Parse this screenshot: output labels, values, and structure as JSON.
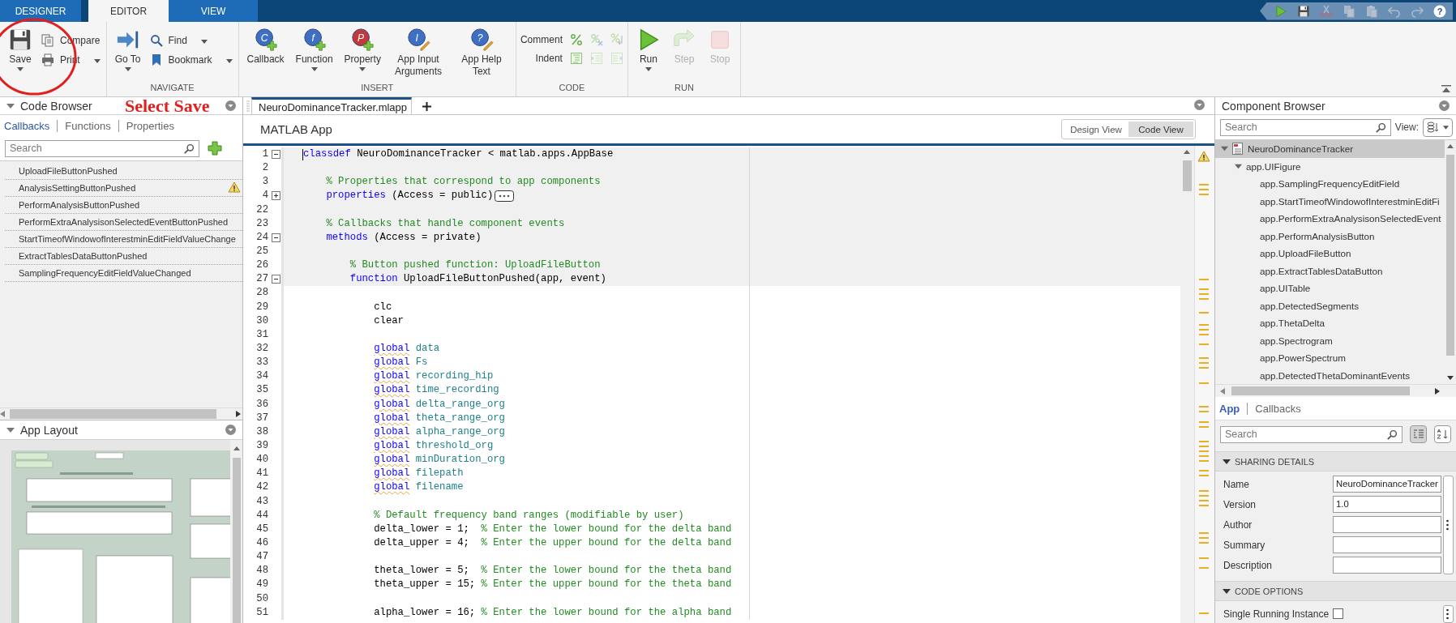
{
  "ribbon_tabs": [
    {
      "label": "DESIGNER",
      "selected": false
    },
    {
      "label": "EDITOR",
      "selected": true
    },
    {
      "label": "VIEW",
      "selected": false
    }
  ],
  "quick_access": [
    {
      "kind": "run",
      "disabled": false
    },
    {
      "kind": "save",
      "disabled": false
    },
    {
      "kind": "cut",
      "disabled": true
    },
    {
      "kind": "copy",
      "disabled": true
    },
    {
      "kind": "paste",
      "disabled": true
    },
    {
      "kind": "undo",
      "disabled": true
    },
    {
      "kind": "redo",
      "disabled": true
    },
    {
      "kind": "help",
      "disabled": false,
      "glyph": "?"
    }
  ],
  "ribbon": [
    {
      "large": [
        {
          "kind": "save",
          "label": "Save",
          "dropdown": true,
          "disabled": false
        }
      ],
      "small": [
        {
          "kind": "compare",
          "label": "Compare",
          "dropdown": false
        },
        {
          "kind": "print",
          "label": "Print",
          "dropdown": true
        }
      ]
    },
    {
      "label": "NAVIGATE",
      "large": [
        {
          "kind": "goto",
          "label": "Go To",
          "dropdown": true,
          "disabled": false
        }
      ],
      "small": [
        {
          "kind": "find",
          "label": "Find",
          "dropdown": true
        },
        {
          "kind": "bookmark",
          "label": "Bookmark",
          "dropdown": true
        }
      ]
    },
    {
      "label": "INSERT",
      "large": [
        {
          "kind": "callback",
          "label": "Callback",
          "glyph": "C",
          "dropdown": false,
          "disabled": false
        },
        {
          "kind": "function",
          "label": "Function",
          "glyph": "f",
          "dropdown": true,
          "disabled": false
        },
        {
          "kind": "property",
          "label": "Property",
          "glyph": "P",
          "dropdown": true,
          "disabled": false
        },
        {
          "kind": "app-input",
          "label": "App Input Arguments",
          "glyph": "I",
          "dropdown": false,
          "disabled": false
        },
        {
          "kind": "app-help",
          "label": "App Help Text",
          "glyph": "?",
          "dropdown": false,
          "disabled": false
        }
      ]
    },
    {
      "label": "CODE",
      "icon_rows": [
        {
          "label": "Comment",
          "tools": [
            {
              "kind": "comment",
              "disabled": false
            },
            {
              "kind": "uncomment",
              "disabled": true
            },
            {
              "kind": "wrap-comment",
              "disabled": true
            }
          ]
        },
        {
          "label": "Indent",
          "tools": [
            {
              "kind": "smart-indent",
              "disabled": false
            },
            {
              "kind": "increase-indent",
              "disabled": true
            },
            {
              "kind": "decrease-indent",
              "disabled": true
            }
          ]
        }
      ]
    },
    {
      "label": "RUN",
      "large": [
        {
          "kind": "run",
          "label": "Run",
          "dropdown": true,
          "disabled": false
        },
        {
          "kind": "step",
          "label": "Step",
          "dropdown": false,
          "disabled": true
        },
        {
          "kind": "stop",
          "label": "Stop",
          "dropdown": false,
          "disabled": true
        }
      ]
    }
  ],
  "annotation": {
    "text": "Select Save"
  },
  "code_browser": {
    "title": "Code Browser",
    "tabs": [
      {
        "label": "Callbacks",
        "selected": true
      },
      {
        "label": "Functions",
        "selected": false
      },
      {
        "label": "Properties",
        "selected": false
      }
    ],
    "search": {
      "placeholder": "Search"
    },
    "items": [
      {
        "label": "UploadFileButtonPushed",
        "warning": false
      },
      {
        "label": "AnalysisSettingButtonPushed",
        "warning": true
      },
      {
        "label": "PerformAnalysisButtonPushed",
        "warning": false
      },
      {
        "label": "PerformExtraAnalysisonSelectedEventButtonPushed",
        "warning": false
      },
      {
        "label": "StartTimeofWindowofInterestminEditFieldValueChange",
        "warning": false
      },
      {
        "label": "ExtractTablesDataButtonPushed",
        "warning": false
      },
      {
        "label": "SamplingFrequencyEditFieldValueChanged",
        "warning": false
      }
    ]
  },
  "app_layout": {
    "title": "App Layout"
  },
  "editor": {
    "file_tab": {
      "label": "NeuroDominanceTracker.mlapp",
      "selected": true
    },
    "title": "MATLAB App",
    "views": [
      {
        "label": "Design View",
        "selected": false
      },
      {
        "label": "Code View",
        "selected": true
      }
    ],
    "lines": [
      {
        "number": "1",
        "expanded": true,
        "editable": false,
        "cursor": true,
        "segments": [
          {
            "kind": "keyword",
            "text": "classdef"
          },
          {
            "kind": "plain",
            "text": " NeuroDominanceTracker < matlab.apps.AppBase"
          }
        ]
      },
      {
        "number": "2",
        "editable": false
      },
      {
        "number": "3",
        "editable": false,
        "segments": [
          {
            "kind": "comment",
            "text": "    % Properties that correspond to app components"
          }
        ]
      },
      {
        "number": "4",
        "expanded": false,
        "editable": false,
        "collapsed": true,
        "segments": [
          {
            "kind": "keyword",
            "text": "    properties"
          },
          {
            "kind": "plain",
            "text": " (Access = public)"
          }
        ]
      },
      {
        "number": "22",
        "editable": false
      },
      {
        "number": "23",
        "editable": false,
        "segments": [
          {
            "kind": "comment",
            "text": "    % Callbacks that handle component events"
          }
        ]
      },
      {
        "number": "24",
        "expanded": true,
        "editable": false,
        "segments": [
          {
            "kind": "keyword",
            "text": "    methods"
          },
          {
            "kind": "plain",
            "text": " (Access = private)"
          }
        ]
      },
      {
        "number": "25",
        "editable": false
      },
      {
        "number": "26",
        "editable": false,
        "segments": [
          {
            "kind": "comment",
            "text": "        % Button pushed function: UploadFileButton"
          }
        ]
      },
      {
        "number": "27",
        "expanded": true,
        "editable": false,
        "segments": [
          {
            "kind": "keyword",
            "text": "        function"
          },
          {
            "kind": "plain",
            "text": " UploadFileButtonPushed(app, event)"
          }
        ]
      },
      {
        "number": "28",
        "editable": true
      },
      {
        "number": "29",
        "editable": true,
        "segments": [
          {
            "kind": "plain",
            "text": "            clc"
          }
        ]
      },
      {
        "number": "30",
        "editable": true,
        "segments": [
          {
            "kind": "plain",
            "text": "            clear"
          }
        ]
      },
      {
        "number": "31",
        "editable": true
      },
      {
        "number": "32",
        "editable": true,
        "segments": [
          {
            "kind": "keyword",
            "text": "            global",
            "flagged": true
          },
          {
            "kind": "variable",
            "text": " data"
          }
        ]
      },
      {
        "number": "33",
        "editable": true,
        "segments": [
          {
            "kind": "keyword",
            "text": "            global",
            "flagged": true
          },
          {
            "kind": "variable",
            "text": " Fs"
          }
        ]
      },
      {
        "number": "34",
        "editable": true,
        "segments": [
          {
            "kind": "keyword",
            "text": "            global",
            "flagged": true
          },
          {
            "kind": "variable",
            "text": " recording_hip"
          }
        ]
      },
      {
        "number": "35",
        "editable": true,
        "segments": [
          {
            "kind": "keyword",
            "text": "            global",
            "flagged": true
          },
          {
            "kind": "variable",
            "text": " time_recording"
          }
        ]
      },
      {
        "number": "36",
        "editable": true,
        "segments": [
          {
            "kind": "keyword",
            "text": "            global",
            "flagged": true
          },
          {
            "kind": "variable",
            "text": " delta_range_org"
          }
        ]
      },
      {
        "number": "37",
        "editable": true,
        "segments": [
          {
            "kind": "keyword",
            "text": "            global",
            "flagged": true
          },
          {
            "kind": "variable",
            "text": " theta_range_org"
          }
        ]
      },
      {
        "number": "38",
        "editable": true,
        "segments": [
          {
            "kind": "keyword",
            "text": "            global",
            "flagged": true
          },
          {
            "kind": "variable",
            "text": " alpha_range_org"
          }
        ]
      },
      {
        "number": "39",
        "editable": true,
        "segments": [
          {
            "kind": "keyword",
            "text": "            global",
            "flagged": true
          },
          {
            "kind": "variable",
            "text": " threshold_org"
          }
        ]
      },
      {
        "number": "40",
        "editable": true,
        "segments": [
          {
            "kind": "keyword",
            "text": "            global",
            "flagged": true
          },
          {
            "kind": "variable",
            "text": " minDuration_org"
          }
        ]
      },
      {
        "number": "41",
        "editable": true,
        "segments": [
          {
            "kind": "keyword",
            "text": "            global",
            "flagged": true
          },
          {
            "kind": "variable",
            "text": " filepath"
          }
        ]
      },
      {
        "number": "42",
        "editable": true,
        "segments": [
          {
            "kind": "keyword",
            "text": "            global",
            "flagged": true
          },
          {
            "kind": "variable",
            "text": " filename"
          }
        ]
      },
      {
        "number": "43",
        "editable": true
      },
      {
        "number": "44",
        "editable": true,
        "segments": [
          {
            "kind": "comment",
            "text": "            % Default frequency band ranges (modifiable by user)"
          }
        ]
      },
      {
        "number": "45",
        "editable": true,
        "segments": [
          {
            "kind": "plain",
            "text": "            delta_lower = 1;  "
          },
          {
            "kind": "comment",
            "text": "% Enter the lower bound for the delta band"
          }
        ]
      },
      {
        "number": "46",
        "editable": true,
        "segments": [
          {
            "kind": "plain",
            "text": "            delta_upper = 4;  "
          },
          {
            "kind": "comment",
            "text": "% Enter the upper bound for the delta band"
          }
        ]
      },
      {
        "number": "47",
        "editable": true
      },
      {
        "number": "48",
        "editable": true,
        "segments": [
          {
            "kind": "plain",
            "text": "            theta_lower = 5;  "
          },
          {
            "kind": "comment",
            "text": "% Enter the lower bound for the theta band"
          }
        ]
      },
      {
        "number": "49",
        "editable": true,
        "segments": [
          {
            "kind": "plain",
            "text": "            theta_upper = 15; "
          },
          {
            "kind": "comment",
            "text": "% Enter the upper bound for the theta band"
          }
        ]
      },
      {
        "number": "50",
        "editable": true
      },
      {
        "number": "51",
        "editable": true,
        "segments": [
          {
            "kind": "plain",
            "text": "            alpha_lower = 16; "
          },
          {
            "kind": "comment",
            "text": "% Enter the lower bound for the alpha band"
          }
        ]
      }
    ]
  },
  "component_browser": {
    "title": "Component Browser",
    "search": {
      "placeholder": "Search"
    },
    "view_label": "View:",
    "tree": [
      {
        "label": "NeuroDominanceTracker",
        "selected": true,
        "expanded": true,
        "children": [
          {
            "label": "app.UIFigure",
            "selected": false,
            "expanded": true,
            "children": [
              {
                "label": "app.SamplingFrequencyEditField",
                "selected": false
              },
              {
                "label": "app.StartTimeofWindowofInterestminEditFi",
                "selected": false
              },
              {
                "label": "app.PerformExtraAnalysisonSelectedEvent",
                "selected": false
              },
              {
                "label": "app.PerformAnalysisButton",
                "selected": false
              },
              {
                "label": "app.UploadFileButton",
                "selected": false
              },
              {
                "label": "app.ExtractTablesDataButton",
                "selected": false
              },
              {
                "label": "app.UITable",
                "selected": false
              },
              {
                "label": "app.DetectedSegments",
                "selected": false
              },
              {
                "label": "app.ThetaDelta",
                "selected": false
              },
              {
                "label": "app.Spectrogram",
                "selected": false
              },
              {
                "label": "app.PowerSpectrum",
                "selected": false
              },
              {
                "label": "app.DetectedThetaDominantEvents",
                "selected": false
              }
            ]
          }
        ]
      }
    ]
  },
  "inspector": {
    "tabs": [
      {
        "label": "App",
        "selected": true
      },
      {
        "label": "Callbacks",
        "selected": false
      }
    ],
    "search": {
      "placeholder": "Search"
    },
    "sort_buttons": [
      {
        "kind": "grouped",
        "selected": true
      },
      {
        "kind": "alphabetical",
        "selected": false
      }
    ],
    "sections": [
      {
        "label": "SHARING DETAILS",
        "expanded": true,
        "fields": [
          {
            "kind": "text",
            "label": "Name",
            "value": "NeuroDominanceTracker"
          },
          {
            "kind": "text",
            "label": "Version",
            "value": "1.0"
          },
          {
            "kind": "text",
            "label": "Author"
          },
          {
            "kind": "text",
            "label": "Summary"
          },
          {
            "kind": "text",
            "label": "Description"
          }
        ]
      },
      {
        "label": "CODE OPTIONS",
        "expanded": true,
        "fields": [
          {
            "kind": "checkbox",
            "label": "Single Running Instance",
            "checked": false
          }
        ]
      }
    ]
  }
}
